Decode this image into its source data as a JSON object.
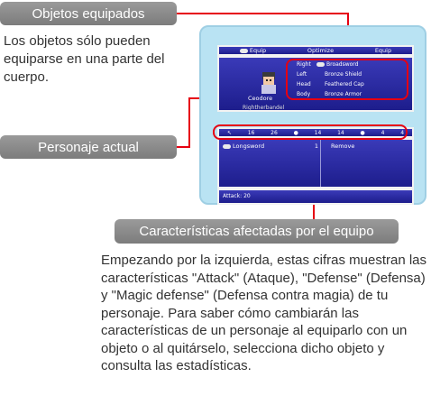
{
  "callouts": {
    "equipped_label": "Objetos equipados",
    "equipped_desc": "Los objetos sólo pueden equiparse en una parte del cuerpo.",
    "character_label": "Personaje actual",
    "stats_label": "Características afectadas por el equipo",
    "stats_desc": "Empezando por la izquierda, estas cifras muestran las características \"Attack\" (Ataque), \"Defense\" (Defensa) y \"Magic defense\" (Defensa contra magia) de tu personaje. Para saber cómo cambiarán las características de un personaje al equiparlo con un objeto o al quitárselo, selecciona dicho objeto y consulta las estadísticas."
  },
  "game": {
    "tabs": [
      "Equip",
      "Optimize",
      "Equip"
    ],
    "character": {
      "name": "Ceodore",
      "job": "Rightherbandel"
    },
    "slots": [
      {
        "part": "Right",
        "item": "Broadsword"
      },
      {
        "part": "Left",
        "item": "Bronze Shield"
      },
      {
        "part": "Head",
        "item": "Feathered Cap"
      },
      {
        "part": "Body",
        "item": "Bronze Armor"
      }
    ],
    "stats": [
      "16",
      "26",
      "14",
      "14",
      "4",
      "4"
    ],
    "list": {
      "item": "Longsword",
      "count": "1",
      "action": "Remove"
    },
    "attack": "Attack: 20"
  }
}
